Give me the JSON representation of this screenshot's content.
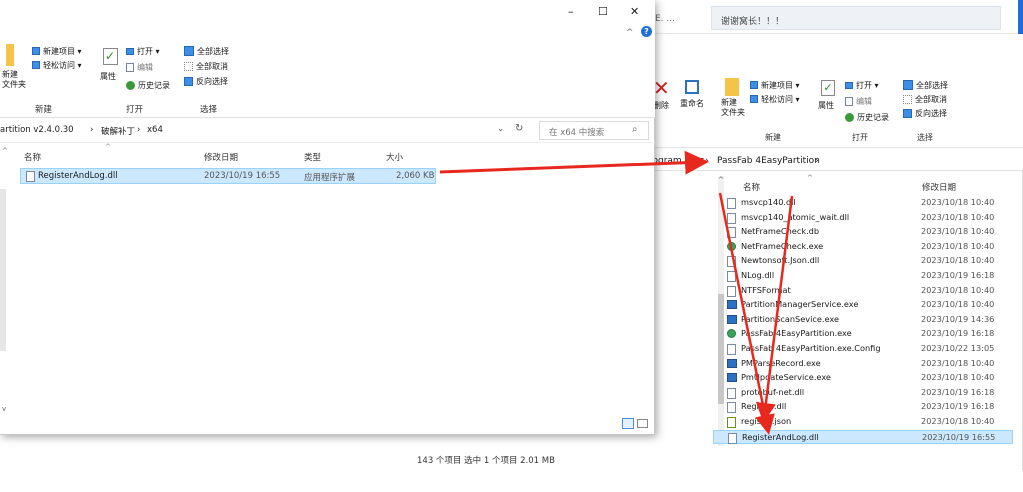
{
  "back_window": {
    "top_strip": {
      "partial_text": "E. ...",
      "right_text": "谢谢窝长！！！"
    },
    "ribbon": {
      "delete": "删除",
      "rename": "重命名",
      "new_folder": "新建\n文件夹",
      "new_item": "新建项目 ▾",
      "easy_access": "轻松访问 ▾",
      "properties": "属性",
      "open": "打开 ▾",
      "edit": "编辑",
      "history": "历史记录",
      "select_all": "全部选择",
      "select_none": "全部取消",
      "invert": "反向选择",
      "group_new": "新建",
      "group_open": "打开",
      "group_select": "选择"
    },
    "address": {
      "partial": "rogram Files",
      "sep": "›",
      "current": "PassFab 4EasyPartition",
      "trail": "›"
    },
    "columns": {
      "name": "名称",
      "date": "修改日期"
    },
    "files": [
      {
        "name": "msvcp140.dll",
        "date": "2023/10/18 10:40",
        "icon": "dll-icon"
      },
      {
        "name": "msvcp140_atomic_wait.dll",
        "date": "2023/10/18 10:40",
        "icon": "dll-icon"
      },
      {
        "name": "NetFrameCheck.db",
        "date": "2023/10/18 10:40",
        "icon": "db-icon"
      },
      {
        "name": "NetFrameCheck.exe",
        "date": "2023/10/18 10:40",
        "icon": "exe-app-icon"
      },
      {
        "name": "Newtonsoft.Json.dll",
        "date": "2023/10/18 10:40",
        "icon": "dll-icon"
      },
      {
        "name": "NLog.dll",
        "date": "2023/10/19 16:18",
        "icon": "dll-icon"
      },
      {
        "name": "NTFSFormat",
        "date": "2023/10/18 10:40",
        "icon": "file-icon"
      },
      {
        "name": "PartitionManagerService.exe",
        "date": "2023/10/18 10:40",
        "icon": "exe-icon"
      },
      {
        "name": "PartitionScanSevice.exe",
        "date": "2023/10/19 14:36",
        "icon": "exe-icon"
      },
      {
        "name": "PassFab 4EasyPartition.exe",
        "date": "2023/10/19 16:18",
        "icon": "exe-app-icon"
      },
      {
        "name": "PassFab 4EasyPartition.exe.Config",
        "date": "2023/10/22 13:05",
        "icon": "file-icon"
      },
      {
        "name": "PMParseRecord.exe",
        "date": "2023/10/18 10:40",
        "icon": "exe-icon"
      },
      {
        "name": "PmUpdateService.exe",
        "date": "2023/10/18 10:40",
        "icon": "exe-icon"
      },
      {
        "name": "protobuf-net.dll",
        "date": "2023/10/19 16:18",
        "icon": "dll-icon"
      },
      {
        "name": "Register.dll",
        "date": "2023/10/19 16:18",
        "icon": "dll-icon"
      },
      {
        "name": "register.json",
        "date": "2023/10/18 10:40",
        "icon": "json-icon"
      },
      {
        "name": "RegisterAndLog.dll",
        "date": "2023/10/19 16:55",
        "icon": "dll-icon",
        "selected": true
      }
    ],
    "status": "143 个项目   选中 1 个项目  2.01 MB"
  },
  "front_window": {
    "title_buttons": {
      "minimize": "–",
      "maximize": "☐",
      "close": "✕",
      "help": "?",
      "chevron": "^"
    },
    "ribbon": {
      "new_folder": "新建\n文件夹",
      "new_item": "新建项目 ▾",
      "easy_access": "轻松访问 ▾",
      "properties": "属性",
      "open": "打开 ▾",
      "edit": "编辑",
      "history": "历史记录",
      "select_all": "全部选择",
      "select_none": "全部取消",
      "invert": "反向选择",
      "group_new": "新建",
      "group_open": "打开",
      "group_select": "选择"
    },
    "address": {
      "part1": "artition v2.4.0.30",
      "sep1": "›",
      "part2": "破解补丁",
      "sep2": "›",
      "part3": "x64"
    },
    "search_placeholder": "在 x64 中搜索",
    "columns": {
      "name": "名称",
      "date": "修改日期",
      "type": "类型",
      "size": "大小"
    },
    "file": {
      "name": "RegisterAndLog.dll",
      "date": "2023/10/19 16:55",
      "type": "应用程序扩展",
      "size": "2,060 KB"
    }
  },
  "colors": {
    "selection": "#cce8ff",
    "arrow": "#e8281e",
    "accent": "#1e6fd9"
  }
}
